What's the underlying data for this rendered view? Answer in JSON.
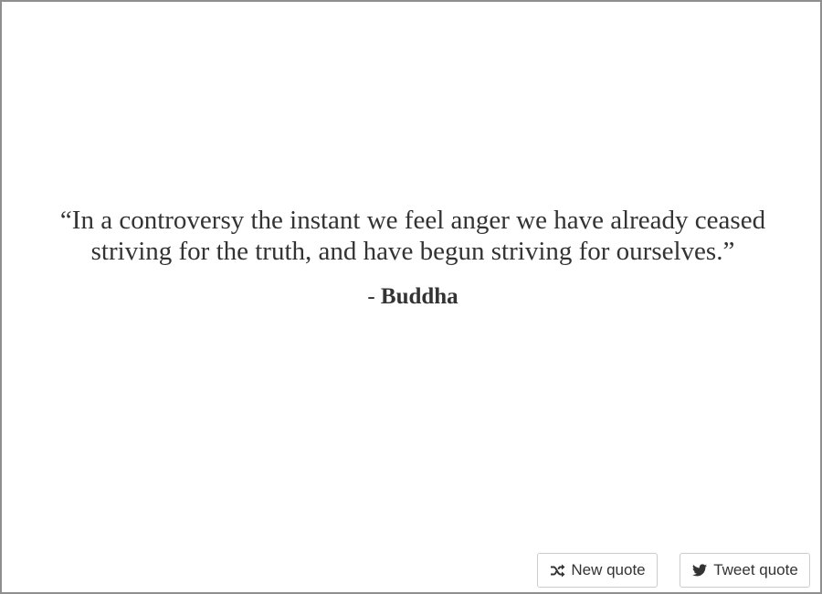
{
  "quote": {
    "open_mark": "“",
    "text": "In a controversy the instant we feel anger we have already ceased striving for the truth, and have begun striving for ourselves.",
    "close_mark": "”"
  },
  "author": {
    "prefix": "- ",
    "name": "Buddha"
  },
  "buttons": {
    "new_quote": {
      "label": "New quote",
      "icon": "shuffle-icon"
    },
    "tweet_quote": {
      "label": "Tweet quote",
      "icon": "twitter-icon"
    }
  },
  "colors": {
    "text": "#333333",
    "border": "#cccccc",
    "frame": "#8f8f8f"
  }
}
